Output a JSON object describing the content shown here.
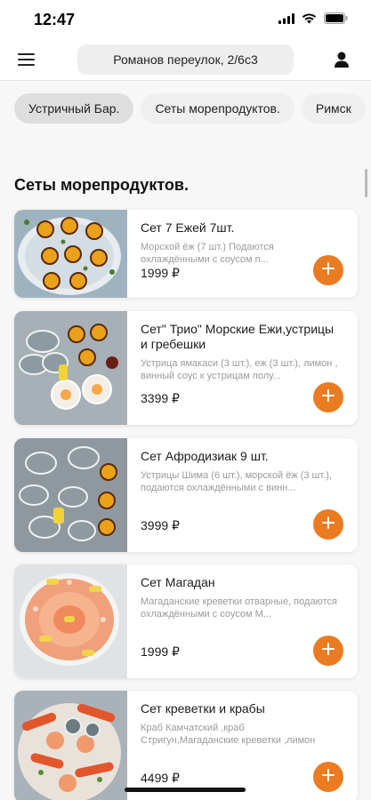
{
  "status_bar": {
    "time": "12:47"
  },
  "header": {
    "address": "Романов переулок, 2/6с3"
  },
  "categories": [
    {
      "label": "Устричный Бар."
    },
    {
      "label": "Сеты морепродуктов."
    },
    {
      "label": "Римск"
    }
  ],
  "section": {
    "title": "Сеты морепродуктов."
  },
  "products": [
    {
      "title": "Сет 7 Ежей  7шт.",
      "desc": "Морской ёж (7 шт.) Подаются охлаждёнными с соусом п...",
      "price": "1999 ₽"
    },
    {
      "title": "Сет\" Трио\" Морские Ежи,устрицы и гребешки",
      "desc": "Устрица ямакаси (3 шт.), еж (3 шт.), лимон , винный соус к устрицам полу...",
      "price": "3399 ₽"
    },
    {
      "title": "Сет Афродизиак 9 шт.",
      "desc": "Устрицы Шима (6 шт.), морской ёж (3 шт.), подаются охлаждёнными с винн...",
      "price": "3999 ₽"
    },
    {
      "title": "Сет Магадан",
      "desc": "Магаданские креветки отварные, подаются охлаждёнными с соусом  М...",
      "price": "1999 ₽"
    },
    {
      "title": "Сет креветки и крабы",
      "desc": "Краб Камчатский ,краб Стригун,Магаданские креветки ,лимон ,соус...",
      "price": "4499 ₽"
    }
  ],
  "colors": {
    "accent": "#EA7B21",
    "background": "#F7F7F7",
    "card": "#FFFFFF"
  }
}
